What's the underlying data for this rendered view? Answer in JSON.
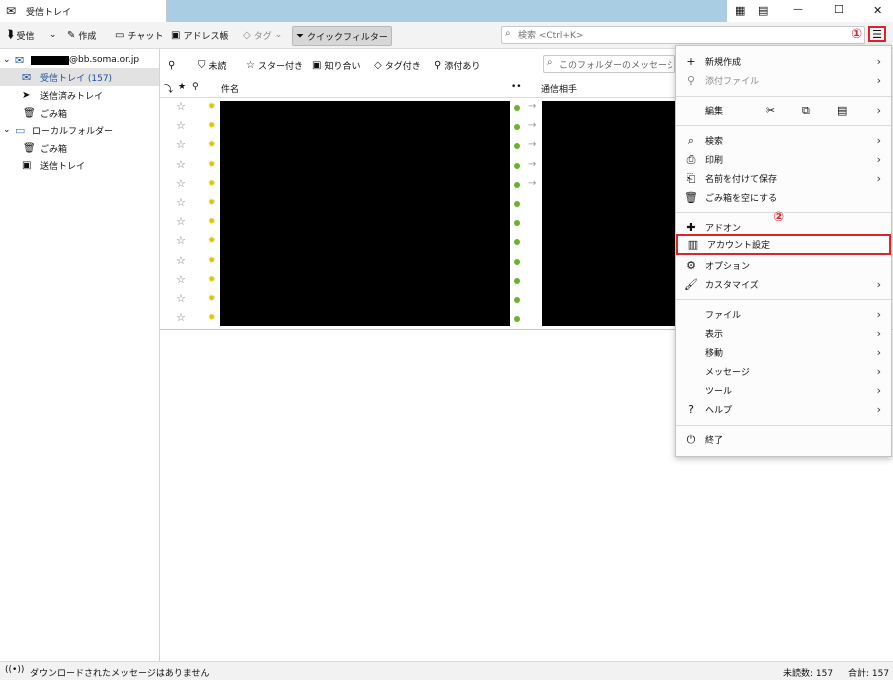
{
  "window": {
    "tab_title": "受信トレイ",
    "controls": {
      "minimize": "—",
      "maximize": "☐",
      "close": "✕"
    }
  },
  "toolbar": {
    "get_mail": "受信",
    "write": "作成",
    "chat": "チャット",
    "address_book": "アドレス帳",
    "tag": "タグ",
    "quick_filter": "クイックフィルター",
    "search_placeholder": "検索 <Ctrl+K>",
    "menu_glyph": "☰"
  },
  "annotations": {
    "one": "①",
    "two": "②"
  },
  "sidebar": {
    "account": "@bb.soma.or.jp",
    "items": [
      {
        "label": "受信トレイ (157)"
      },
      {
        "label": "送信済みトレイ"
      },
      {
        "label": "ごみ箱"
      },
      {
        "label": "ローカルフォルダー"
      },
      {
        "label": "ごみ箱"
      },
      {
        "label": "送信トレイ"
      }
    ]
  },
  "quick_filter_bar": {
    "unread": "未読",
    "starred": "スター付き",
    "contacts": "知り合い",
    "tags": "タグ付き",
    "attachments": "添付あり",
    "filter_placeholder": "このフォルダーのメッセージを絞り"
  },
  "table": {
    "columns": {
      "subject": "件名",
      "correspondent": "通信相手"
    }
  },
  "menu": {
    "new": "新規作成",
    "attach": "添付ファイル",
    "edit": "編集",
    "find": "検索",
    "print": "印刷",
    "save_as": "名前を付けて保存",
    "empty_trash": "ごみ箱を空にする",
    "addons": "アドオン",
    "account_settings": "アカウント設定",
    "options": "オプション",
    "customize": "カスタマイズ",
    "file": "ファイル",
    "view": "表示",
    "go": "移動",
    "message": "メッセージ",
    "tools": "ツール",
    "help": "ヘルプ",
    "quit": "終了"
  },
  "status": {
    "message": "ダウンロードされたメッセージはありません",
    "unread": "未読数: 157",
    "total": "合計: 157"
  },
  "colors": {
    "accent": "#1a4f9b",
    "highlight": "#d7262e",
    "titlebar": "#a9cde3"
  }
}
